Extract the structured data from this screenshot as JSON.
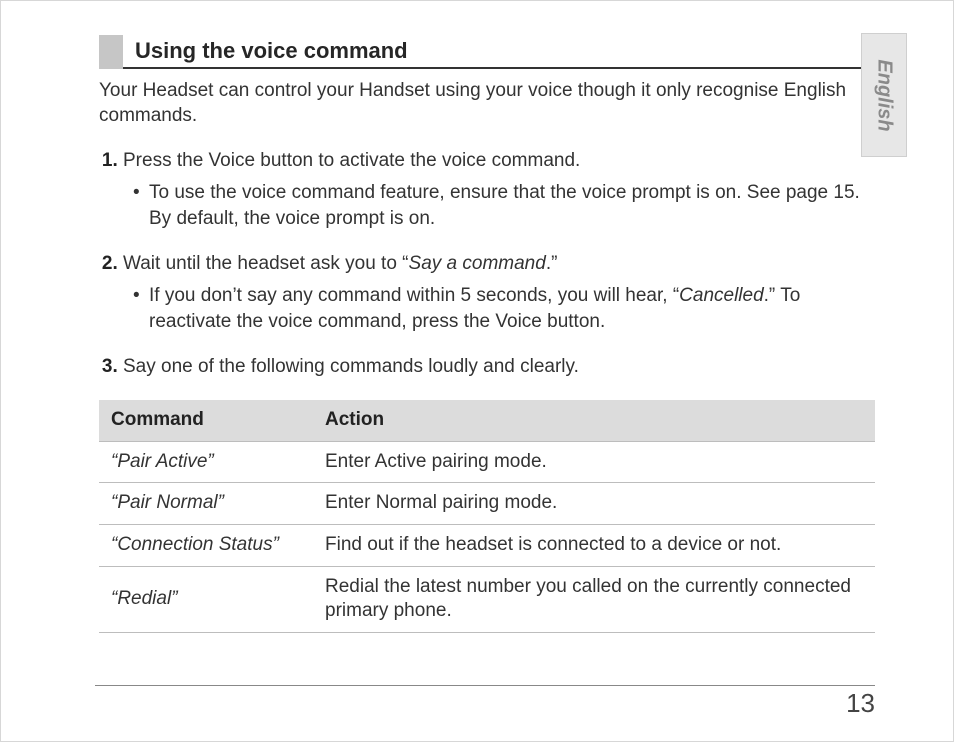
{
  "tab": {
    "label": "English"
  },
  "section": {
    "title": "Using the voice command",
    "intro": "Your Headset can control your Handset using your voice though it only recognise English commands."
  },
  "steps": [
    {
      "text": "Press the Voice button to activate the voice command.",
      "sub": [
        "To use the voice command feature, ensure that the voice prompt is on. See page 15. By default, the voice prompt is on."
      ]
    },
    {
      "text_parts": [
        "Wait until the headset ask you to “",
        "Say a command",
        ".”"
      ],
      "sub_parts": [
        [
          "If you don’t say any command within 5 seconds, you will hear, “",
          "Cancelled",
          ".” To reactivate the voice command, press the Voice button."
        ]
      ]
    },
    {
      "text": "Say one of the following commands loudly and clearly."
    }
  ],
  "table": {
    "headers": [
      "Command",
      "Action"
    ],
    "rows": [
      {
        "command": "“Pair Active”",
        "action": "Enter Active pairing mode."
      },
      {
        "command": "“Pair Normal”",
        "action": "Enter Normal pairing mode."
      },
      {
        "command": "“Connection Status”",
        "action": "Find out if the headset is connected to a device or not."
      },
      {
        "command": "“Redial”",
        "action": "Redial the latest number you called on the currently connected primary phone."
      }
    ]
  },
  "page_number": "13"
}
